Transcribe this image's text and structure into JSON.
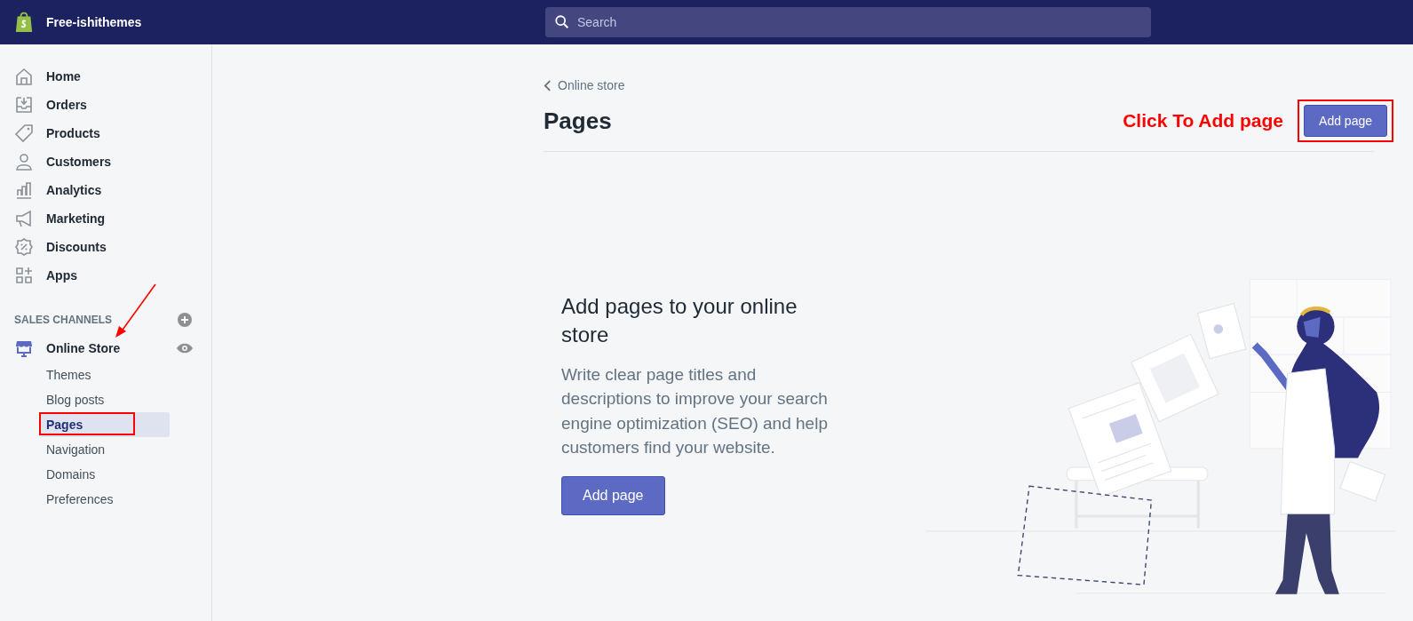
{
  "top_bar": {
    "store_name": "Free-ishithemes",
    "search": {
      "placeholder": "Search"
    }
  },
  "sidebar": {
    "items": [
      {
        "label": "Home",
        "selected": false
      },
      {
        "label": "Orders",
        "selected": false
      },
      {
        "label": "Products",
        "selected": false
      },
      {
        "label": "Customers",
        "selected": false
      },
      {
        "label": "Analytics",
        "selected": false
      },
      {
        "label": "Marketing",
        "selected": false
      },
      {
        "label": "Discounts",
        "selected": false
      },
      {
        "label": "Apps",
        "selected": false
      }
    ],
    "section_title": "SALES CHANNELS",
    "channel": {
      "label": "Online Store",
      "annotated_arrow": true,
      "children": [
        {
          "label": "Themes",
          "selected": false,
          "annotated": false
        },
        {
          "label": "Blog posts",
          "selected": false,
          "annotated": false
        },
        {
          "label": "Pages",
          "selected": true,
          "annotated": true
        },
        {
          "label": "Navigation",
          "selected": false,
          "annotated": false
        },
        {
          "label": "Domains",
          "selected": false,
          "annotated": false
        },
        {
          "label": "Preferences",
          "selected": false,
          "annotated": false
        }
      ]
    }
  },
  "page": {
    "breadcrumb": "Online store",
    "title": "Pages",
    "annotation": "Click To Add page",
    "primary_button": {
      "label": "Add page",
      "annotated": true
    },
    "empty_state": {
      "heading": "Add pages to your online store",
      "text": "Write clear page titles and descriptions to improve your search engine optimization (SEO) and help customers find your website.",
      "button": "Add page"
    }
  }
}
